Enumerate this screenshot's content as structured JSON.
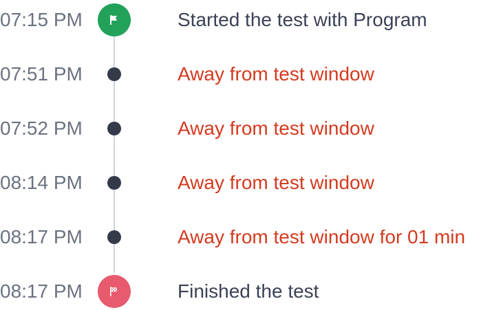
{
  "colors": {
    "time_text": "#6b7280",
    "normal_text": "#3b4256",
    "alert_text": "#d43a1f",
    "dot": "#343a4a",
    "start_marker": "#22a15a",
    "finish_marker": "#e85a6e",
    "rail": "#d0d3d8"
  },
  "events": [
    {
      "time": "07:15 PM",
      "icon": "flag-icon",
      "text": "Started the test with Program"
    },
    {
      "time": "07:51 PM",
      "icon": "dot-icon",
      "text": "Away from test window"
    },
    {
      "time": "07:52 PM",
      "icon": "dot-icon",
      "text": "Away from test window"
    },
    {
      "time": "08:14 PM",
      "icon": "dot-icon",
      "text": "Away from test window"
    },
    {
      "time": "08:17 PM",
      "icon": "dot-icon",
      "text": "Away from test window for 01 min"
    },
    {
      "time": "08:17 PM",
      "icon": "checkered-flag-icon",
      "text": "Finished the test"
    }
  ]
}
